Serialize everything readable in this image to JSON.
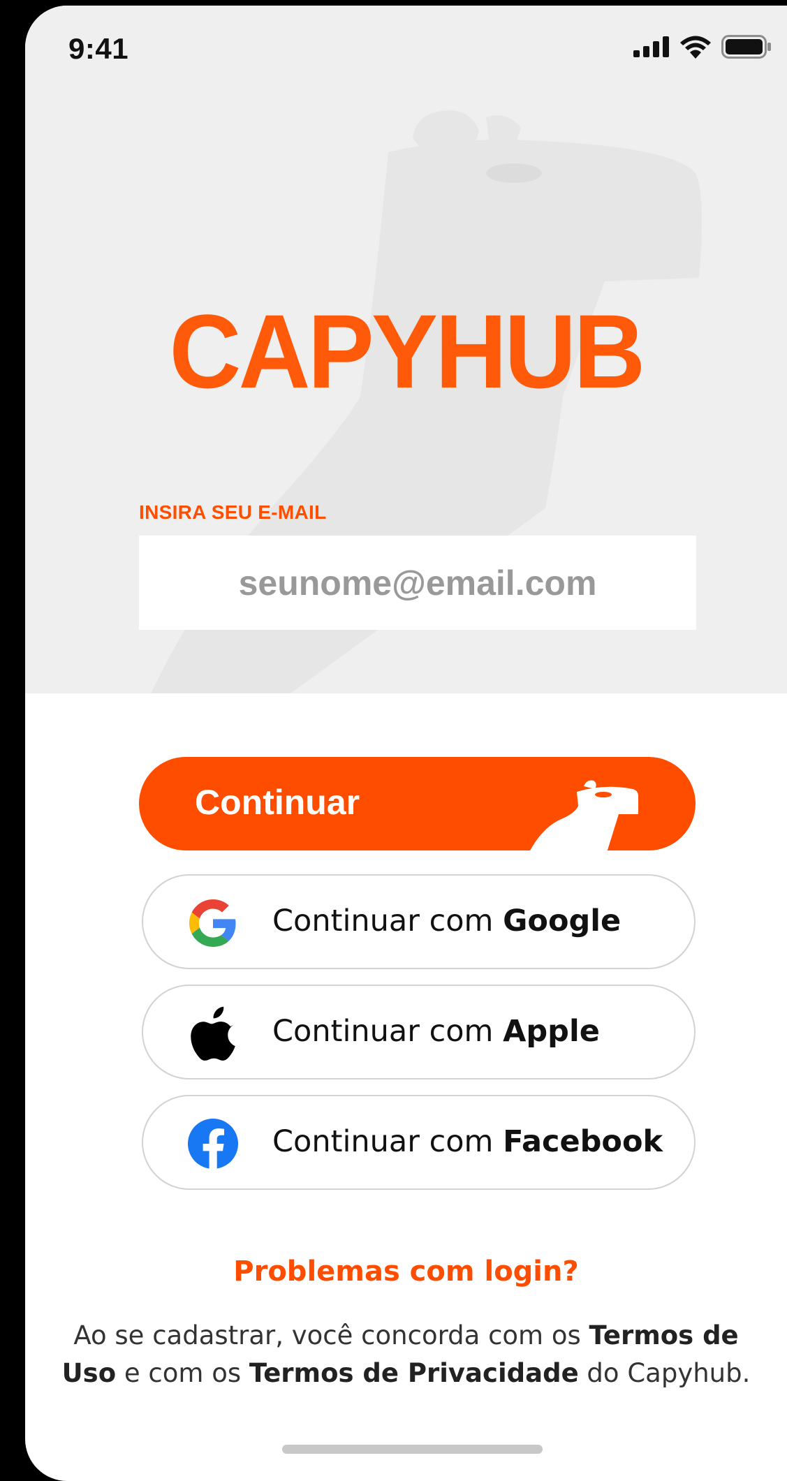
{
  "status_bar": {
    "time": "9:41"
  },
  "brand": {
    "logo_text": "CAPYHUB",
    "accent_color": "#ff4d00"
  },
  "login": {
    "email_label": "INSIRA SEU E-MAIL",
    "email_placeholder": "seunome@email.com",
    "continue_label": "Continuar"
  },
  "social": [
    {
      "prefix": "Continuar com ",
      "provider": "Google",
      "icon": "google-icon"
    },
    {
      "prefix": "Continuar com ",
      "provider": "Apple",
      "icon": "apple-icon"
    },
    {
      "prefix": "Continuar com ",
      "provider": "Facebook",
      "icon": "facebook-icon"
    }
  ],
  "help": {
    "problems_link": "Problemas com login?"
  },
  "terms": {
    "part1": "Ao se cadastrar, você concorda com os ",
    "terms_of_use": "Termos de Uso",
    "part2": " e com os ",
    "privacy_terms": "Termos de Privacidade",
    "part3": " do Capyhub."
  }
}
